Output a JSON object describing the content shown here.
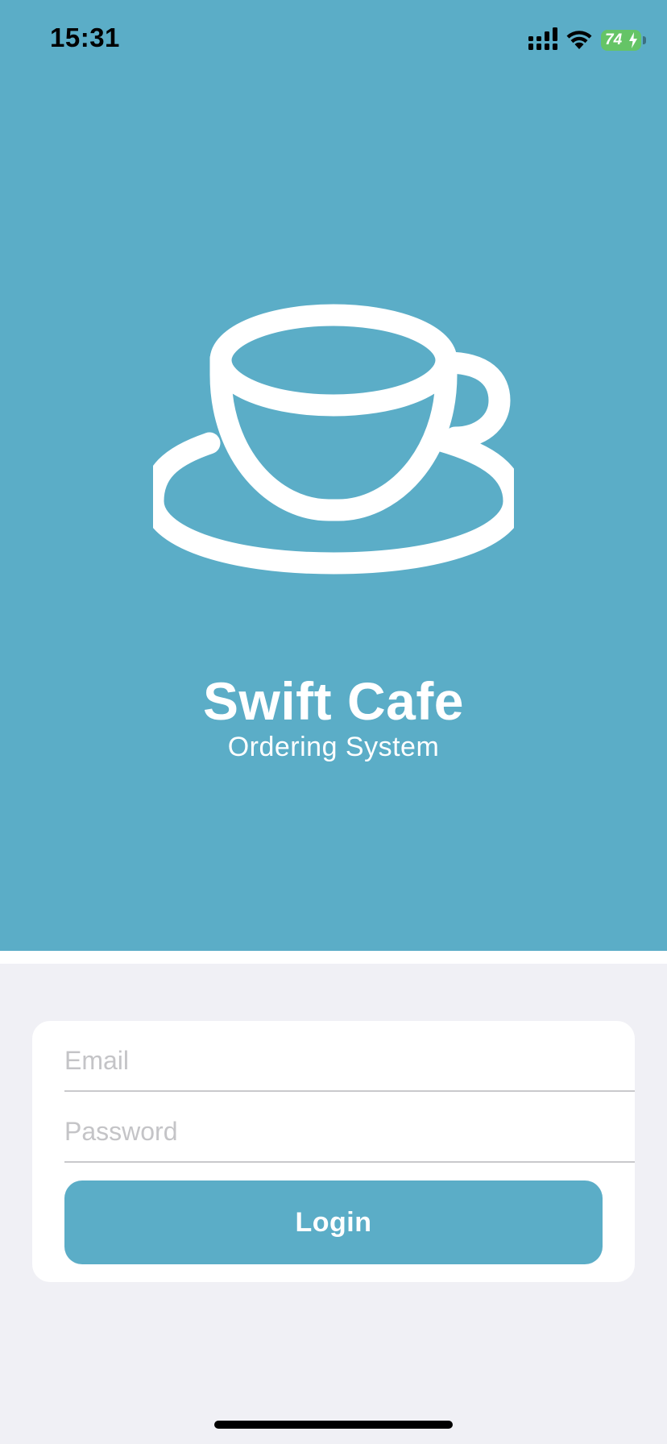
{
  "status_bar": {
    "time": "15:31",
    "battery_level": "74",
    "icons": [
      "cellular-signal-icon",
      "wifi-icon",
      "battery-charging-icon"
    ]
  },
  "hero": {
    "logo_icon": "coffee-cup-icon",
    "title": "Swift Cafe",
    "subtitle": "Ordering System"
  },
  "login_form": {
    "email": {
      "value": "",
      "placeholder": "Email"
    },
    "password": {
      "value": "",
      "placeholder": "Password"
    },
    "login_label": "Login"
  },
  "colors": {
    "brand": "#5BADC7",
    "background": "#F0F0F5",
    "card": "#FFFFFF",
    "battery": "#65C466"
  }
}
